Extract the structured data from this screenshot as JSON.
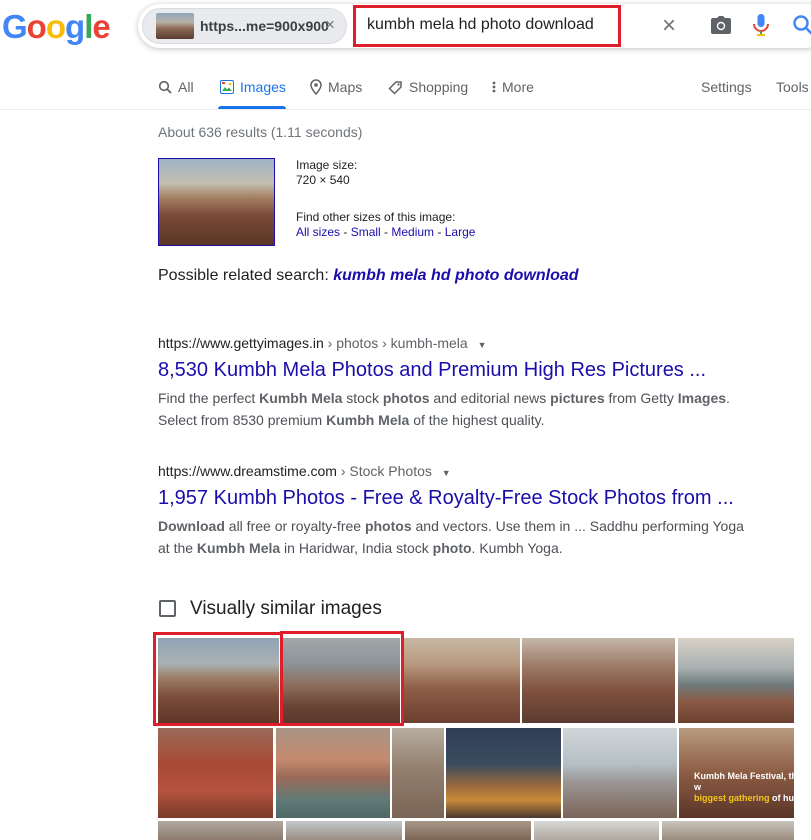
{
  "header": {
    "logo_letters": [
      "G",
      "o",
      "o",
      "g",
      "l",
      "e"
    ],
    "logo_colors": [
      "#4285f4",
      "#ea4335",
      "#fbbc05",
      "#4285f4",
      "#34a853",
      "#ea4335"
    ],
    "chip_text": "https...me=900x900",
    "chip_close": "×",
    "query": "kumbh mela hd photo download",
    "clear": "×"
  },
  "tabs": [
    {
      "label": "All",
      "icon": "search-icon"
    },
    {
      "label": "Images",
      "icon": "images-icon",
      "active": true
    },
    {
      "label": "Maps",
      "icon": "map-pin-icon"
    },
    {
      "label": "Shopping",
      "icon": "tag-icon"
    },
    {
      "label": "More",
      "icon": "more-vert-icon"
    }
  ],
  "settings": "Settings",
  "tools": "Tools",
  "stats": "About 636 results (1.11 seconds)",
  "image_info": {
    "size_label": "Image size:",
    "size_value": "720 × 540",
    "find_label": "Find other sizes of this image:",
    "links": [
      "All sizes",
      "Small",
      "Medium",
      "Large"
    ],
    "sep": " - "
  },
  "related": {
    "label": "Possible related search:",
    "query": "kumbh mela hd photo download"
  },
  "results": [
    {
      "cite_host": "https://www.gettyimages.in",
      "cite_path": " › photos › kumbh-mela",
      "title": "8,530 Kumbh Mela Photos and Premium High Res Pictures ...",
      "snippet_line1": [
        "Find the perfect ",
        "Kumbh Mela",
        " stock ",
        "photos",
        " and editorial news ",
        "pictures",
        " from Getty ",
        "Images",
        "."
      ],
      "snippet_line2": [
        "Select from 8530 premium ",
        "Kumbh Mela",
        " of the highest quality."
      ]
    },
    {
      "cite_host": "https://www.dreamstime.com",
      "cite_path": " › Stock Photos",
      "title": "1,957 Kumbh Photos - Free & Royalty-Free Stock Photos from ...",
      "snippet_line1": [
        "Download",
        " all free or royalty-free ",
        "photos",
        " and vectors. Use them in ... Saddhu performing Yoga"
      ],
      "snippet_line2": [
        "at the ",
        "Kumbh Mela",
        " in Haridwar, India stock ",
        "photo",
        ". Kumbh Yoga."
      ]
    }
  ],
  "visually_similar": {
    "title": "Visually similar images",
    "overlay_line1": "Kumbh Mela Festival, the w",
    "overlay_line2a": "biggest gathering",
    "overlay_line2b": " of hum"
  }
}
